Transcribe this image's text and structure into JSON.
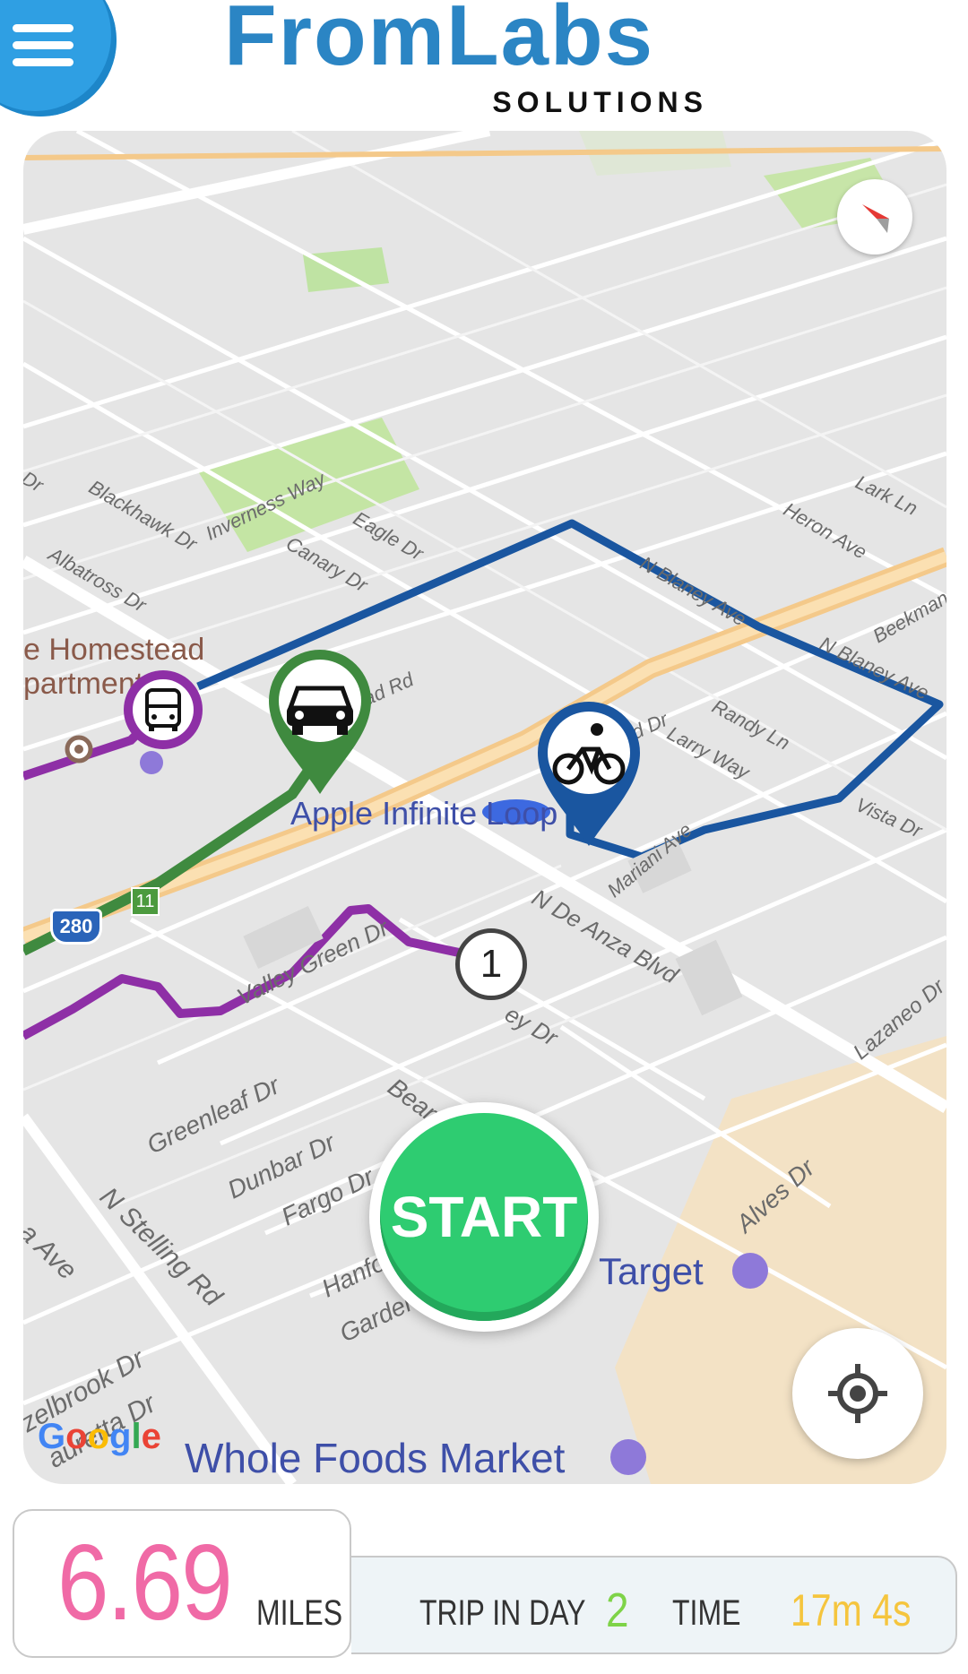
{
  "header": {
    "menu_icon": "hamburger-menu-icon",
    "logo_main": "FromLabs",
    "logo_sub": "SOLUTIONS",
    "accent_color": "#2b85c4"
  },
  "map": {
    "provider": "Google",
    "poi": {
      "apple": "Apple Infinite Loop",
      "target": "Target",
      "whole_foods": "Whole Foods Market",
      "homestead_line1": "e Homestead",
      "homestead_line2": "partment"
    },
    "streets": {
      "homestead_rd": "Homestead Rd",
      "n_blaney_ave_1": "N Blaney Ave",
      "n_blaney_ave_2": "N Blaney Ave",
      "northwood": "Northwood Dr",
      "randy": "Randy Ln",
      "larry": "Larry Way",
      "mariani": "Mariani Ave",
      "vista": "Vista Dr",
      "n_de_anza": "N De Anza Blvd",
      "valley_green": "Valley Green Dr",
      "greenleaf": "Greenleaf Dr",
      "dunbar": "Dunbar Dr",
      "fargo": "Fargo Dr",
      "beardon": "Beardon Dr",
      "hanford": "Hanford Dr",
      "gardengate": "Gardengate Dr",
      "alves": "Alves Dr",
      "n_stelling": "N Stelling Rd",
      "hazelbrook": "zelbrook Dr",
      "lauretta": "auretta Dr",
      "lazaneo": "Lazaneo Dr",
      "lark": "Lark Ln",
      "heron": "Heron Ave",
      "beekman": "Beekman Pl",
      "blackhawk": "Blackhawk Dr",
      "inverness": "Inverness Way",
      "eagle": "Eagle Dr",
      "canary": "Canary Dr",
      "albatross": "Albatross Dr",
      "ey_dr": "ey Dr",
      "a_ave": "a Ave",
      "dr_left": "Dr"
    },
    "highway_badges": {
      "interstate": "280",
      "route": "11"
    },
    "route_colors": {
      "bike_route": "#1a56a0",
      "car_route": "#3f8a3f",
      "bus_route": "#8e2fa6"
    },
    "markers": {
      "bus": "bus-icon",
      "car": "car-icon",
      "bike": "bicycle-icon",
      "stop_number": "1"
    },
    "start_label": "START"
  },
  "stats": {
    "miles_value": "6.69",
    "miles_unit": "MILES",
    "trip_label": "TRIP IN DAY",
    "trip_value": "2",
    "time_label": "TIME",
    "time_value": "17m 4s",
    "colors": {
      "miles": "#f06aa6",
      "trip": "#7ed348",
      "time": "#f5c53e"
    }
  }
}
